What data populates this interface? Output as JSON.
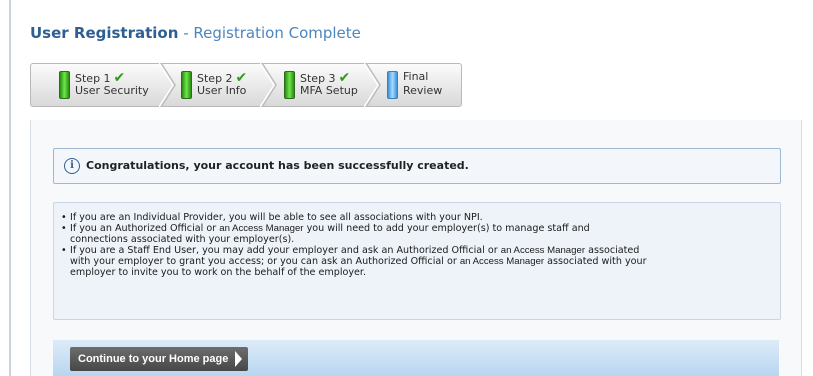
{
  "header": {
    "title": "User Registration",
    "separator": " - ",
    "subtitle": "Registration Complete"
  },
  "steps": [
    {
      "line1": "Step 1",
      "line2": "User Security",
      "status": "complete",
      "icon": "check-icon"
    },
    {
      "line1": "Step 2",
      "line2": "User Info",
      "status": "complete",
      "icon": "check-icon"
    },
    {
      "line1": "Step 3",
      "line2": "MFA Setup",
      "status": "complete",
      "icon": "check-icon"
    },
    {
      "line1": "Final",
      "line2": "Review",
      "status": "current"
    }
  ],
  "alert": {
    "icon": "info-icon",
    "message": "Congratulations, your account has been successfully created."
  },
  "notes": {
    "item1": "If you are an Individual Provider, you will be able to see all associations with your NPI.",
    "item2_a": "If you an Authorized Official or",
    "item2_b": "an Access Manager",
    "item2_c": "you will need to add your employer(s) to manage staff and",
    "item2_d": "connections associated with your employer(s).",
    "item3_a": "If you are a Staff End User, you may add your employer and ask an Authorized Official or",
    "item3_b": "an Access Manager",
    "item3_c": "associated",
    "item3_d": "with your employer to grant you access; or you can ask an Authorized Official or",
    "item3_e": "an Access Manager",
    "item3_f": "associated with your",
    "item3_g": "employer to invite you to work on the behalf of the employer."
  },
  "actions": {
    "continue_label": "Continue to your Home page"
  },
  "colors": {
    "title": "#2f5f92",
    "subtitle": "#4b86bd",
    "step_complete": "#2a8c12",
    "step_current": "#3b93d8"
  }
}
